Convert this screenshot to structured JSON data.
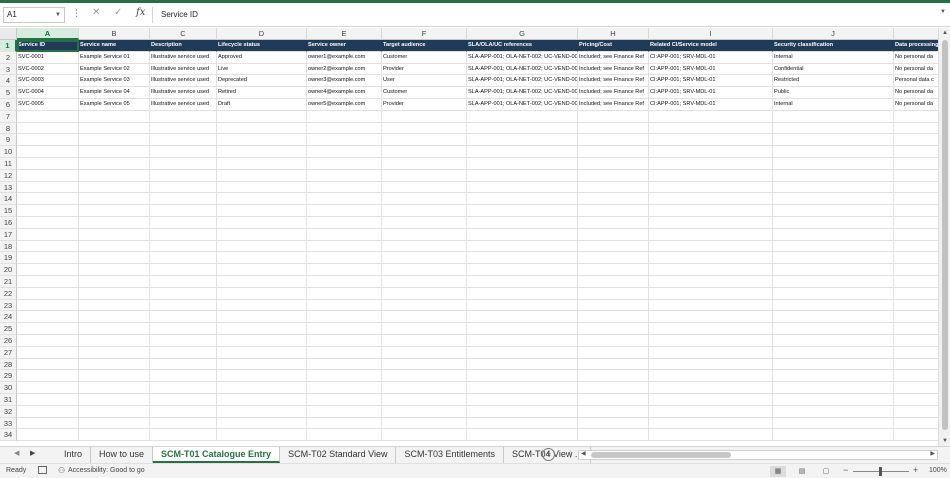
{
  "formula_bar": {
    "name_box": "A1",
    "formula": "Service ID"
  },
  "columns": [
    "A",
    "B",
    "C",
    "D",
    "E",
    "F",
    "G",
    "H",
    "I",
    "J",
    ""
  ],
  "row_numbers": [
    "1",
    "2",
    "3",
    "4",
    "5",
    "6",
    "7",
    "8",
    "9",
    "10",
    "11",
    "12",
    "13",
    "14",
    "15",
    "16",
    "17",
    "18",
    "19",
    "20",
    "21",
    "22",
    "23",
    "24",
    "25",
    "26",
    "27",
    "28",
    "29",
    "30",
    "31",
    "32",
    "33",
    "34"
  ],
  "table": {
    "headers": [
      "Service ID",
      "Service name",
      "Description",
      "Lifecycle status",
      "Service owner",
      "Target audience",
      "SLA/OLA/UC references",
      "Pricing/Cost",
      "Related CI/Service model",
      "Security classification",
      "Data processing"
    ],
    "rows": [
      [
        "SVC-0001",
        "Example Service 01",
        "Illustrative service used",
        "Approved",
        "owner1@example.com",
        "Customer",
        "SLA-APP-001; OLA-NET-002; UC-VEND-003",
        "Included; see Finance Ref",
        "CI:APP-001; SRV-MDL-01",
        "Internal",
        "No personal da"
      ],
      [
        "SVC-0002",
        "Example Service 02",
        "Illustrative service used",
        "Live",
        "owner2@example.com",
        "Provider",
        "SLA-APP-001; OLA-NET-002; UC-VEND-003",
        "Included; see Finance Ref",
        "CI:APP-001; SRV-MDL-01",
        "Confidential",
        "No personal da"
      ],
      [
        "SVC-0003",
        "Example Service 03",
        "Illustrative service used",
        "Deprecated",
        "owner3@example.com",
        "User",
        "SLA-APP-001; OLA-NET-002; UC-VEND-003",
        "Included; see Finance Ref",
        "CI:APP-001; SRV-MDL-01",
        "Restricted",
        "Personal data c"
      ],
      [
        "SVC-0004",
        "Example Service 04",
        "Illustrative service used",
        "Retired",
        "owner4@example.com",
        "Customer",
        "SLA-APP-001; OLA-NET-002; UC-VEND-003",
        "Included; see Finance Ref",
        "CI:APP-001; SRV-MDL-01",
        "Public",
        "No personal da"
      ],
      [
        "SVC-0005",
        "Example Service 05",
        "Illustrative service used",
        "Draft",
        "owner5@example.com",
        "Provider",
        "SLA-APP-001; OLA-NET-002; UC-VEND-003",
        "Included; see Finance Ref",
        "CI:APP-001; SRV-MDL-01",
        "Internal",
        "No personal da"
      ]
    ]
  },
  "sheet_tabs": [
    "Intro",
    "How to use",
    "SCM-T01 Catalogue Entry",
    "SCM-T02 Standard View",
    "SCM-T03 Entitlements",
    "SCM-T04 View ..."
  ],
  "active_tab": "SCM-T01 Catalogue Entry",
  "status": {
    "ready": "Ready",
    "accessibility": "Accessibility: Good to go",
    "zoom": "100%"
  },
  "colors": {
    "accent": "#217346",
    "header_fill": "#1f3b57"
  }
}
